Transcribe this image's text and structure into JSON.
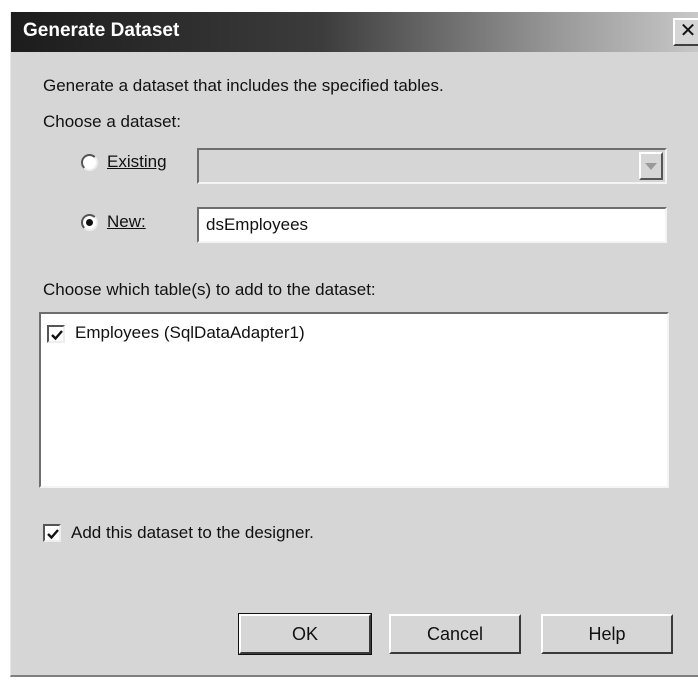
{
  "dialog": {
    "title": "Generate Dataset",
    "close_glyph": "✕",
    "description": "Generate a dataset that includes the specified tables.",
    "choose_dataset_label": "Choose a dataset:",
    "existing": {
      "label": "Existing",
      "selected": false,
      "value": ""
    },
    "new": {
      "label": "New:",
      "selected": true,
      "value": "dsEmployees"
    },
    "tables_label": "Choose which table(s) to add to the dataset:",
    "tables": [
      {
        "label": "Employees (SqlDataAdapter1)",
        "checked": true
      }
    ],
    "add_to_designer": {
      "label": "Add this dataset to the designer.",
      "checked": true
    },
    "buttons": {
      "ok": "OK",
      "cancel": "Cancel",
      "help": "Help"
    }
  }
}
